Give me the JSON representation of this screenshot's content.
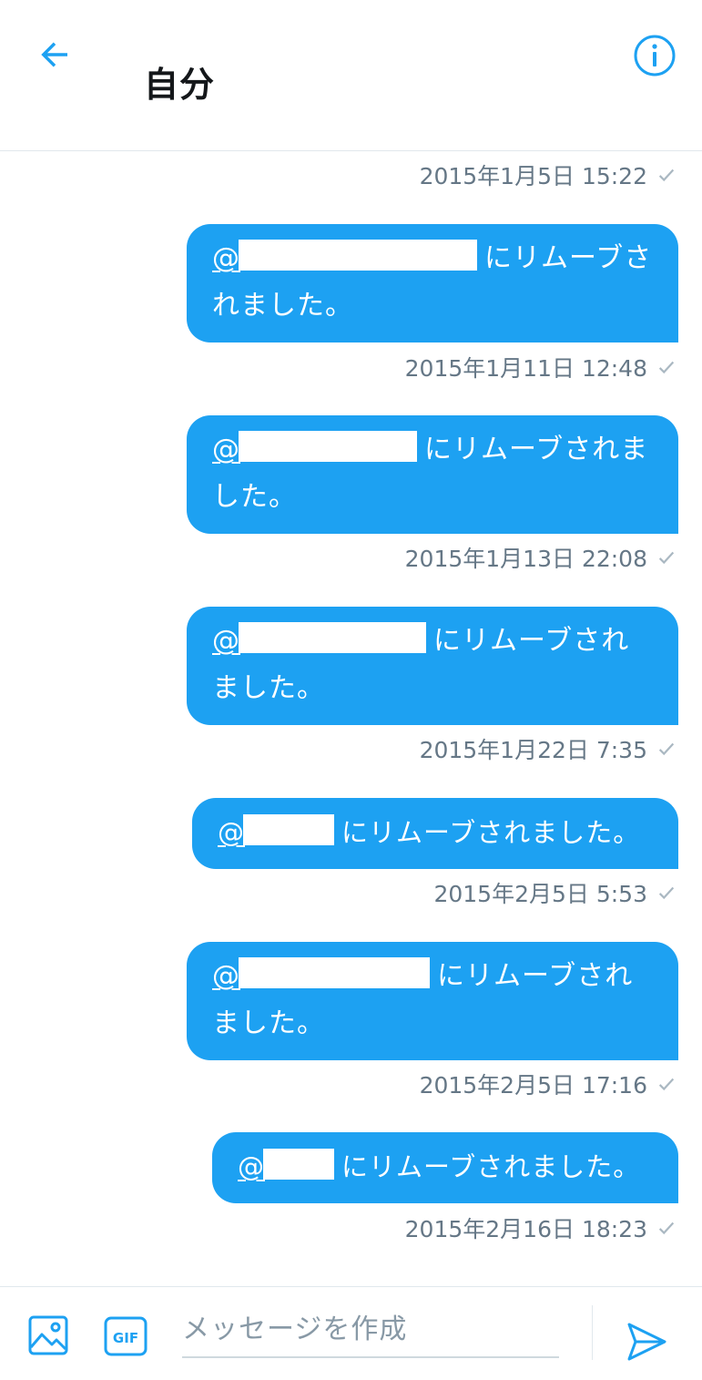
{
  "header": {
    "title": "自分",
    "back_icon": "arrow-left-icon",
    "info_icon": "info-icon",
    "accent": "#1da1f2"
  },
  "thread": {
    "top_timestamp": "2015年1月5日 15:22",
    "messages": [
      {
        "line1_prefix": "@",
        "line1_suffix": "にリムーブさ",
        "line2": "れました。",
        "timestamp": "2015年1月11日 12:48"
      },
      {
        "line1_prefix": "@",
        "line1_suffix": "にリムーブされま",
        "line2": "した。",
        "timestamp": "2015年1月13日 22:08"
      },
      {
        "line1_prefix": "@",
        "line1_suffix": "にリムーブされ",
        "line2": "ました。",
        "timestamp": "2015年1月22日 7:35"
      },
      {
        "line1_prefix": "@",
        "line1_suffix": "にリムーブされました。",
        "line2": "",
        "timestamp": "2015年2月5日 5:53"
      },
      {
        "line1_prefix": "@",
        "line1_suffix": "にリムーブされ",
        "line2": "ました。",
        "timestamp": "2015年2月5日 17:16"
      },
      {
        "line1_prefix": "@",
        "line1_suffix": "にリムーブされました。",
        "line2": "",
        "timestamp": "2015年2月16日 18:23"
      }
    ],
    "bubble_color": "#1da1f2",
    "read_icon": "check-icon"
  },
  "composer": {
    "placeholder": "メッセージを作成",
    "value": "",
    "media_icon": "image-icon",
    "gif_icon": "gif-icon",
    "gif_label": "GIF",
    "send_icon": "send-icon"
  }
}
